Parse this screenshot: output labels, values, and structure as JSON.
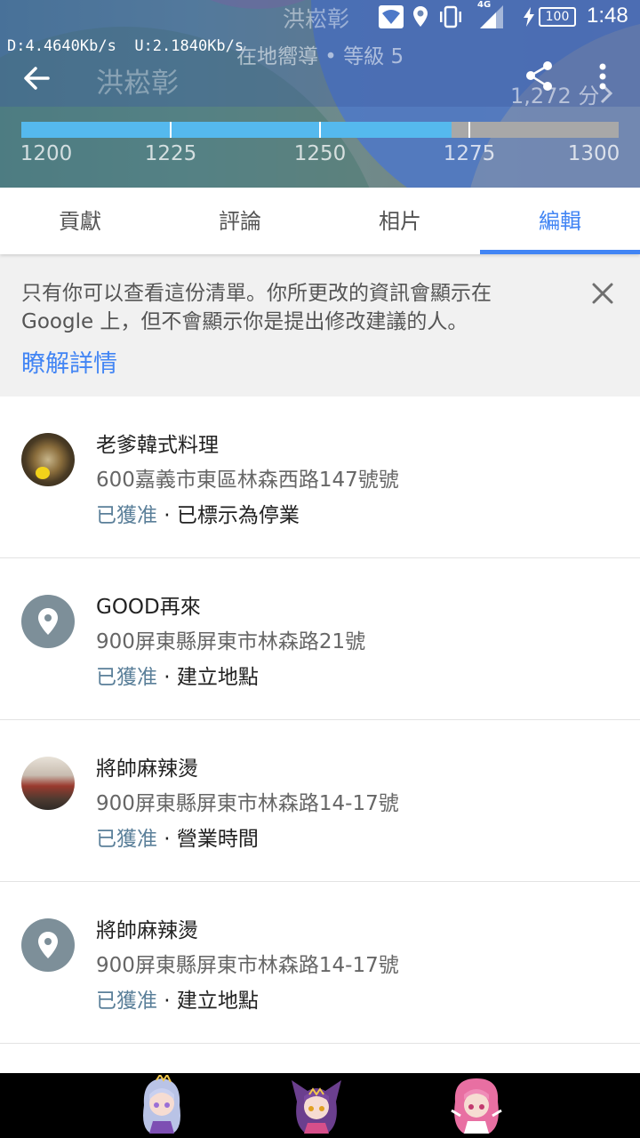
{
  "status_bar": {
    "title_overlay": "洪崧彰",
    "network_type": "4G",
    "battery": "100",
    "time": "1:48"
  },
  "net_speed": {
    "download": "D:4.4640Kb/s",
    "upload": "U:2.1840Kb/s"
  },
  "profile": {
    "name": "洪崧彰",
    "subtitle": "在地嚮導 • 等級 5",
    "points": "1,272 分"
  },
  "progress": {
    "value": 1272,
    "min": 1200,
    "max": 1300,
    "ticks": [
      "1200",
      "1225",
      "1250",
      "1275",
      "1300"
    ]
  },
  "tabs": [
    {
      "label": "貢獻"
    },
    {
      "label": "評論"
    },
    {
      "label": "相片"
    },
    {
      "label": "編輯"
    }
  ],
  "active_tab": "編輯",
  "notice": {
    "text": "只有你可以查看這份清單。你所更改的資訊會顯示在 Google 上，但不會顯示你是提出修改建議的人。",
    "link": "瞭解詳情"
  },
  "edits": [
    {
      "avatar": "food-photo",
      "name": "老爹韓式料理",
      "address": "600嘉義市東區林森西路147號號",
      "status": "已獲准",
      "action": " · 已標示為停業"
    },
    {
      "avatar": "place-pin-icon",
      "name": "GOOD再來",
      "address": "900屏東縣屏東市林森路21號",
      "status": "已獲准",
      "action": " · 建立地點"
    },
    {
      "avatar": "restaurant-photo",
      "name": "將帥麻辣燙",
      "address": "900屏東縣屏東市林森路14-17號",
      "status": "已獲准",
      "action": " · 營業時間"
    },
    {
      "avatar": "place-pin-icon",
      "name": "將帥麻辣燙",
      "address": "900屏東縣屏東市林森路14-17號",
      "status": "已獲准",
      "action": " · 建立地點"
    }
  ],
  "colors": {
    "accent": "#4285f4",
    "progress_fill": "#55b9ee",
    "approved": "#5a7f99",
    "pin_avatar": "#7d8f99"
  }
}
